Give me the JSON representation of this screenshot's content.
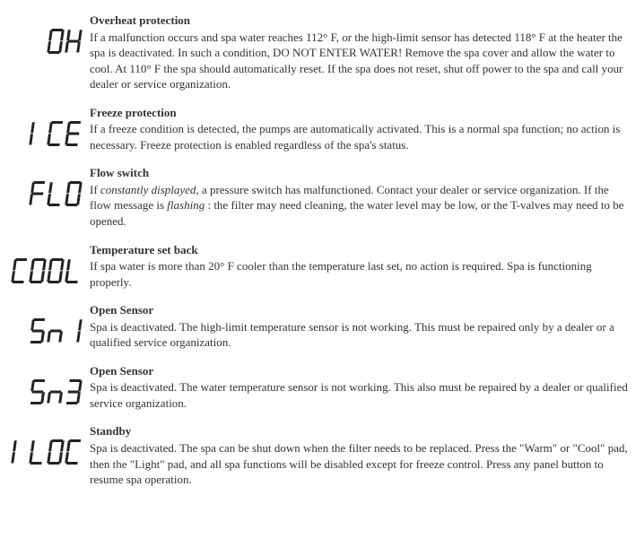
{
  "entries": [
    {
      "code": "OH",
      "title": "Overheat protection",
      "body": "If a malfunction occurs and spa water reaches 112° F, or the high-limit sensor has detected 118° F at the heater the spa is deactivated.  In such a condition, DO NOT ENTER WATER!  Remove the spa cover and allow the water to cool.  At 110° F the spa should automatically reset.  If the spa does not reset, shut off power to the spa and call your dealer or service organization."
    },
    {
      "code": "ICE",
      "title": "Freeze protection",
      "body": "If a freeze condition is detected, the pumps are automatically activated.  This is a normal spa function; no action is necessary.  Freeze protection is enabled regardless of the spa's status."
    },
    {
      "code": "FLO",
      "title": "Flow switch",
      "body": "If <i>constantly displayed</i>, a pressure switch has malfunctioned.  Contact your dealer or service organization.  If the flow message is <i>flashing</i> : the filter may need cleaning, the water level may be low, or the T-valves may need to be opened."
    },
    {
      "code": "COOL",
      "title": "Temperature set back",
      "body": "If spa water is more than 20° F cooler than the temperature last set, no action is required.  Spa is functioning properly."
    },
    {
      "code": "Sn1",
      "title": "Open Sensor",
      "body": "Spa is deactivated.  The high-limit temperature sensor is not working.  This must be repaired only by a dealer or a qualified service organization."
    },
    {
      "code": "Sn3",
      "title": "Open Sensor",
      "body": "Spa is deactivated.  The water temperature sensor is not working.  This also must be repaired by a dealer or qualified service organization."
    },
    {
      "code": "ILOC",
      "title": "Standby",
      "body": "Spa is deactivated.  The spa can be shut down when the filter needs to be replaced.  Press the \"Warm\" or \"Cool\" pad, then the \"Light\" pad, and all spa functions will be disabled except for freeze control.  Press any panel button to resume spa operation."
    }
  ]
}
